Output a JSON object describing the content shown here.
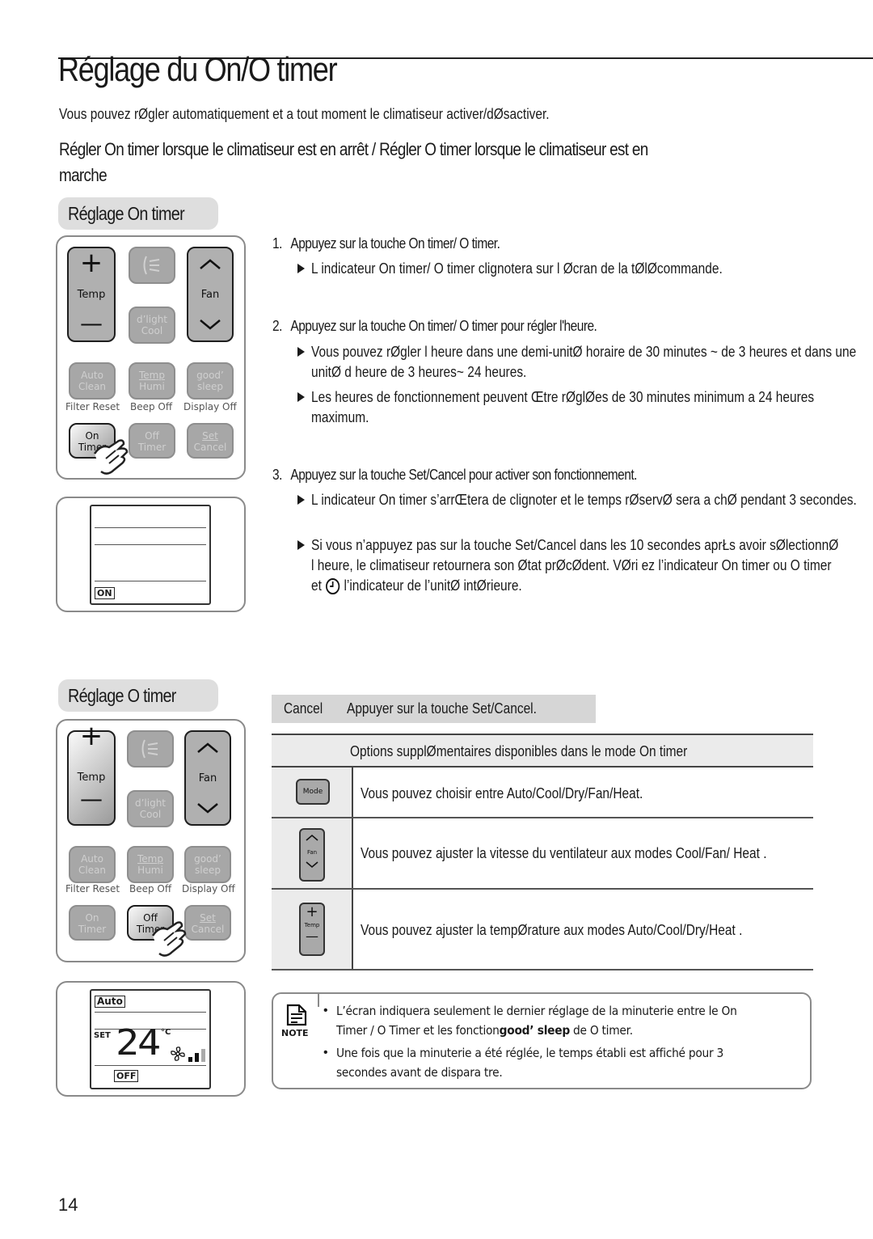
{
  "page": {
    "title": "Réglage du On/O   timer",
    "intro": "Vous pouvez rØgler automatiquement et a tout moment le climatiseur   activer/dØsactiver.",
    "subheading_line1": "Régler On timer  lorsque le climatiseur est en arrêt / Régler O   timer lorsque le climatiseur est en",
    "subheading_line2": "marche",
    "page_number": "14"
  },
  "on_timer_section": {
    "label": "Réglage On timer",
    "remote": {
      "temp_plus": "+",
      "temp_label": "Temp",
      "temp_minus": "—",
      "fan_label": "Fan",
      "dlight_line1": "d’light",
      "dlight_line2": "Cool",
      "auto_line1": "Auto",
      "auto_line2": "Clean",
      "temphumi_line1": "Temp",
      "temphumi_line2": "Humi",
      "goodsleep_line1": "good’",
      "goodsleep_line2": "sleep",
      "filter_reset": "Filter Reset",
      "beep_off": "Beep Off",
      "display_off": "Display Off",
      "on_line1": "On",
      "on_line2": "Timer",
      "off_line1": "Off",
      "off_line2": "Timer",
      "set_line1": "Set",
      "set_line2": "Cancel"
    },
    "display": {
      "indicator": "ON"
    },
    "steps": [
      {
        "number": "1.",
        "text": "Appuyez sur la touche On timer/ O   timer.",
        "bullets": [
          "L indicateur On timer/ O  timer clignotera sur l Øcran de la tØlØcommande."
        ]
      },
      {
        "number": "2.",
        "text": "Appuyez sur la touche On timer/ O   timer pour régler l'heure.",
        "bullets": [
          "Vous pouvez rØgler l heure dans une demi-unitØ horaire de 30 minutes ~ de 3 heures et dans une unitØ d heure de 3 heures~ 24 heures.",
          "Les heures de fonctionnement peuvent Œtre rØglØes de 30 minutes minimum a 24 heures maximum."
        ]
      },
      {
        "number": "3.",
        "text": "Appuyez sur la touche Set/Cancel pour activer son fonctionnement.",
        "bullets": [
          "L indicateur On timer s’arrŒtera de clignoter et le temps rØservØ sera a chØ pendant 3 secondes.",
          "Si vous n’appuyez pas sur la touche Set/Cancel dans les 10 secondes aprŁs avoir sØlectionnØ l heure, le climatiseur retournera   son Øtat prØcØdent. VØri ez l’indicateur On timer ou O  timer et",
          "l’indicateur de l’unitØ intØrieure."
        ]
      }
    ]
  },
  "off_timer_section": {
    "label": "Réglage O   timer",
    "display": {
      "mode": "Auto",
      "set_label": "SET",
      "temperature": "24",
      "unit": "°C",
      "indicator": "OFF",
      "fan_level": 0.67
    }
  },
  "cancel_row": {
    "label": "Cancel",
    "text": "Appuyer sur la touche Set/Cancel."
  },
  "options_table": {
    "header": "Options supplØmentaires disponibles dans le mode On timer",
    "rows": [
      {
        "icon": "mode-button-icon",
        "icon_label": "Mode",
        "text": "Vous pouvez choisir entre Auto/Cool/Dry/Fan/Heat."
      },
      {
        "icon": "fan-button-icon",
        "icon_label": "Fan",
        "text": "Vous pouvez ajuster la vitesse du ventilateur aux modes Cool/Fan/ Heat ."
      },
      {
        "icon": "temp-button-icon",
        "icon_label": "Temp",
        "text": "Vous pouvez ajuster la tempØrature aux modes Auto/Cool/Dry/Heat ."
      }
    ]
  },
  "note": {
    "label": "NOTE",
    "line1": "L’écran indiquera seulement le dernier réglage de la minuterie entre le On",
    "line2_a": "Timer / O  Timer et les fonction",
    "line2_bold": "good’ sleep",
    "line2_b": " de O  timer.",
    "line3": "Une fois que la minuterie a été réglée, le temps établi est affiché pour 3",
    "line4": "secondes avant de dispara tre."
  }
}
